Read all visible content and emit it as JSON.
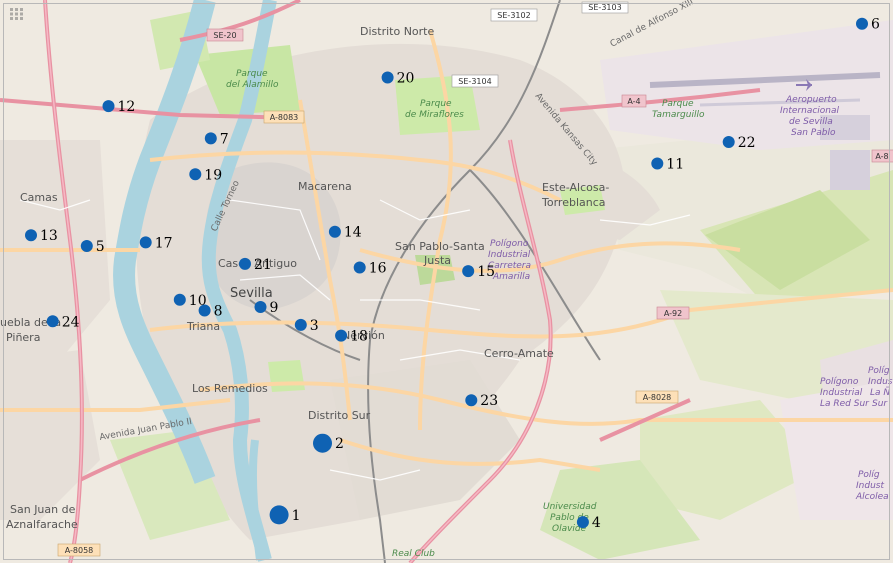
{
  "map": {
    "places": {
      "distrito_norte": "Distrito Norte",
      "macarena": "Macarena",
      "casco_antiguo": "Casco Antiguo",
      "sevilla": "Sevilla",
      "triana": "Triana",
      "los_remedios": "Los Remedios",
      "distrito_sur": "Distrito Sur",
      "nervion": "Nervión",
      "san_pablo_1": "San Pablo-Santa",
      "san_pablo_2": "Justa",
      "cerro_amate": "Cerro-Amate",
      "este_1": "Este-Alcosa-",
      "este_2": "Torreblanca",
      "camas": "Camas",
      "san_juan_1": "San Juan de",
      "san_juan_2": "Aznalfarache",
      "puebla_1": "uebla de la",
      "puebla_2": "Piñera",
      "parque_alamillo_1": "Parque",
      "parque_alamillo_2": "del Alamillo",
      "parque_miraflores_1": "Parque",
      "parque_miraflores_2": "de Miraflores",
      "parque_tamarguillo_1": "Parque",
      "parque_tamarguillo_2": "Tamarguillo",
      "poligono_carretera_1": "Polígono",
      "poligono_carretera_2": "Industrial",
      "poligono_carretera_3": "Carretera",
      "poligono_carretera_4": "Amarilla",
      "poligono_redsur_1": "Polígono",
      "poligono_redsur_2": "Industrial",
      "poligono_redsur_3": "La Red Sur",
      "poligono_right_1": "Políg",
      "poligono_right_2": "Indus",
      "poligono_right_3": "La Ñ",
      "poligono_right_4": "Sur",
      "poligono_alcolea_1": "Políg",
      "poligono_alcolea_2": "Indust",
      "poligono_alcolea_3": "Alcolea",
      "aeropuerto_1": "Aeropuerto",
      "aeropuerto_2": "Internacional",
      "aeropuerto_3": "de Sevilla",
      "aeropuerto_4": "San Pablo",
      "universidad_1": "Universidad",
      "universidad_2": "Pablo de",
      "universidad_3": "Olavide",
      "real_club": "Real Club",
      "avenida_juan_pablo": "Avenida Juan Pablo II",
      "calle_torneo": "Calle Torneo",
      "av_kansas": "Avenida Kansas City",
      "canal_alfonso": "Canal de Alfonso XIII"
    },
    "roads": {
      "se20": "SE-20",
      "a8083": "A-8083",
      "se3102": "SE-3102",
      "se3103": "SE-3103",
      "se3104": "SE-3104",
      "a4": "A-4",
      "a92": "A-92",
      "a8028": "A-8028",
      "a8058": "A-8058",
      "a8": "A-8"
    },
    "points": [
      {
        "id": "1",
        "lat": 37.3565,
        "lon": -5.985,
        "size": "large"
      },
      {
        "id": "2",
        "lat": 37.3665,
        "lon": -5.978,
        "size": "large"
      },
      {
        "id": "3",
        "lat": 37.383,
        "lon": -5.9815,
        "size": "normal"
      },
      {
        "id": "4",
        "lat": 37.3555,
        "lon": -5.936,
        "size": "normal"
      },
      {
        "id": "5",
        "lat": 37.394,
        "lon": -6.016,
        "size": "normal"
      },
      {
        "id": "6",
        "lat": 37.425,
        "lon": -5.891,
        "size": "normal"
      },
      {
        "id": "7",
        "lat": 37.409,
        "lon": -5.996,
        "size": "normal"
      },
      {
        "id": "8",
        "lat": 37.385,
        "lon": -5.997,
        "size": "normal"
      },
      {
        "id": "9",
        "lat": 37.3855,
        "lon": -5.988,
        "size": "normal"
      },
      {
        "id": "10",
        "lat": 37.3865,
        "lon": -6.001,
        "size": "normal"
      },
      {
        "id": "11",
        "lat": 37.4055,
        "lon": -5.924,
        "size": "normal"
      },
      {
        "id": "12",
        "lat": 37.4135,
        "lon": -6.0125,
        "size": "normal"
      },
      {
        "id": "13",
        "lat": 37.3955,
        "lon": -6.025,
        "size": "normal"
      },
      {
        "id": "14",
        "lat": 37.396,
        "lon": -5.976,
        "size": "normal"
      },
      {
        "id": "15",
        "lat": 37.3905,
        "lon": -5.9545,
        "size": "normal"
      },
      {
        "id": "16",
        "lat": 37.391,
        "lon": -5.972,
        "size": "normal"
      },
      {
        "id": "17",
        "lat": 37.3945,
        "lon": -6.0065,
        "size": "normal"
      },
      {
        "id": "18",
        "lat": 37.3815,
        "lon": -5.975,
        "size": "normal"
      },
      {
        "id": "19",
        "lat": 37.404,
        "lon": -5.9985,
        "size": "normal"
      },
      {
        "id": "20",
        "lat": 37.4175,
        "lon": -5.9675,
        "size": "normal"
      },
      {
        "id": "21",
        "lat": 37.3915,
        "lon": -5.9905,
        "size": "normal"
      },
      {
        "id": "22",
        "lat": 37.4085,
        "lon": -5.9125,
        "size": "normal"
      },
      {
        "id": "23",
        "lat": 37.3725,
        "lon": -5.954,
        "size": "normal"
      },
      {
        "id": "24",
        "lat": 37.3835,
        "lon": -6.0215,
        "size": "normal"
      }
    ],
    "marker_color": "#0f62b3",
    "colors": {
      "land": "#f2efe9",
      "urban": "#e5ded6",
      "residential": "#e0dfdf",
      "park": "#cfeaa6",
      "green_field": "#d5e6b8",
      "water": "#aad3df",
      "motorway": "#e892a2",
      "primary": "#fcd6a4",
      "secondary": "#f7fabf",
      "railway": "#8a8a8a"
    }
  }
}
